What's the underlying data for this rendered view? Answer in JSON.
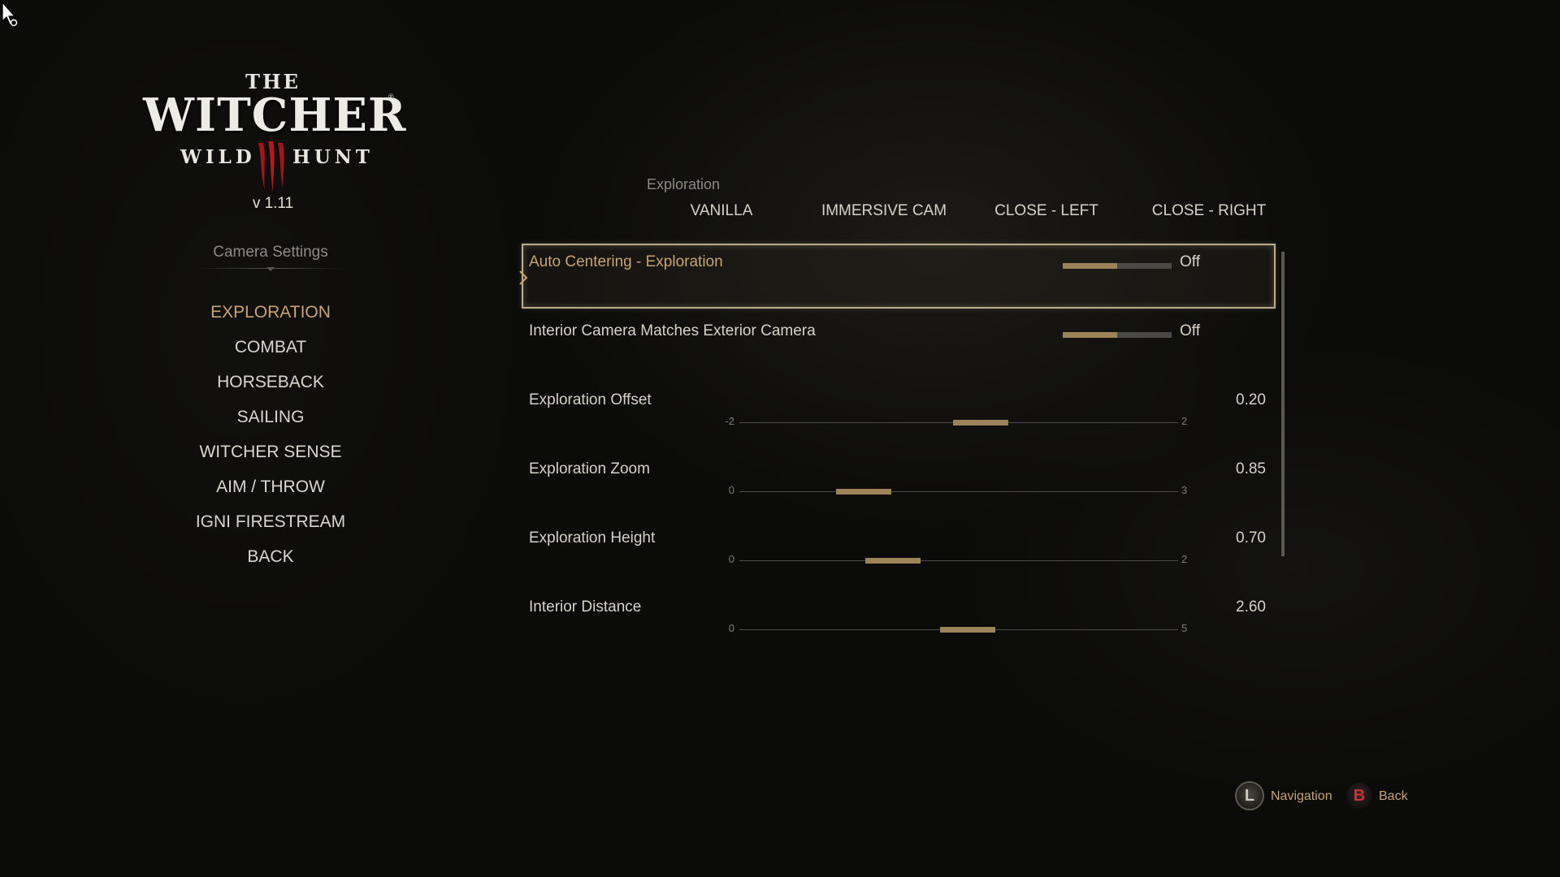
{
  "logo": {
    "the": "THE",
    "main": "WITCHER",
    "tm": "®",
    "wild": "WILD",
    "hunt": "HUNT",
    "version": "v 1.11"
  },
  "menu": {
    "heading": "Camera Settings",
    "items": [
      {
        "label": "EXPLORATION",
        "active": true
      },
      {
        "label": "COMBAT"
      },
      {
        "label": "HORSEBACK"
      },
      {
        "label": "SAILING"
      },
      {
        "label": "WITCHER SENSE"
      },
      {
        "label": "AIM / THROW"
      },
      {
        "label": "IGNI FIRESTREAM"
      },
      {
        "label": "BACK"
      }
    ]
  },
  "section": {
    "label": "Exploration",
    "presets": [
      "VANILLA",
      "IMMERSIVE CAM",
      "CLOSE - LEFT",
      "CLOSE - RIGHT"
    ]
  },
  "settings": [
    {
      "label": "Auto Centering - Exploration",
      "type": "toggle",
      "value": "Off",
      "fill_fraction": 0.5,
      "selected": true
    },
    {
      "label": "Interior Camera Matches Exterior Camera",
      "type": "toggle",
      "value": "Off",
      "fill_fraction": 0.5
    },
    {
      "label": "Exploration Offset",
      "type": "slider",
      "value": "0.20",
      "min": "-2",
      "max": "2",
      "numeric": 0.2,
      "min_num": -2,
      "max_num": 2
    },
    {
      "label": "Exploration Zoom",
      "type": "slider",
      "value": "0.85",
      "min": "0",
      "max": "3",
      "numeric": 0.85,
      "min_num": 0,
      "max_num": 3
    },
    {
      "label": "Exploration Height",
      "type": "slider",
      "value": "0.70",
      "min": "0",
      "max": "2",
      "numeric": 0.7,
      "min_num": 0,
      "max_num": 2
    },
    {
      "label": "Interior Distance",
      "type": "slider",
      "value": "2.60",
      "min": "0",
      "max": "5",
      "numeric": 2.6,
      "min_num": 0,
      "max_num": 5
    }
  ],
  "hints": {
    "navigation": {
      "key": "L",
      "label": "Navigation"
    },
    "back": {
      "key": "B",
      "label": "Back"
    }
  },
  "colors": {
    "accent": "#c8a46e",
    "fill": "#9c8458",
    "text": "#d6d2c8",
    "muted": "#8d8a84"
  }
}
